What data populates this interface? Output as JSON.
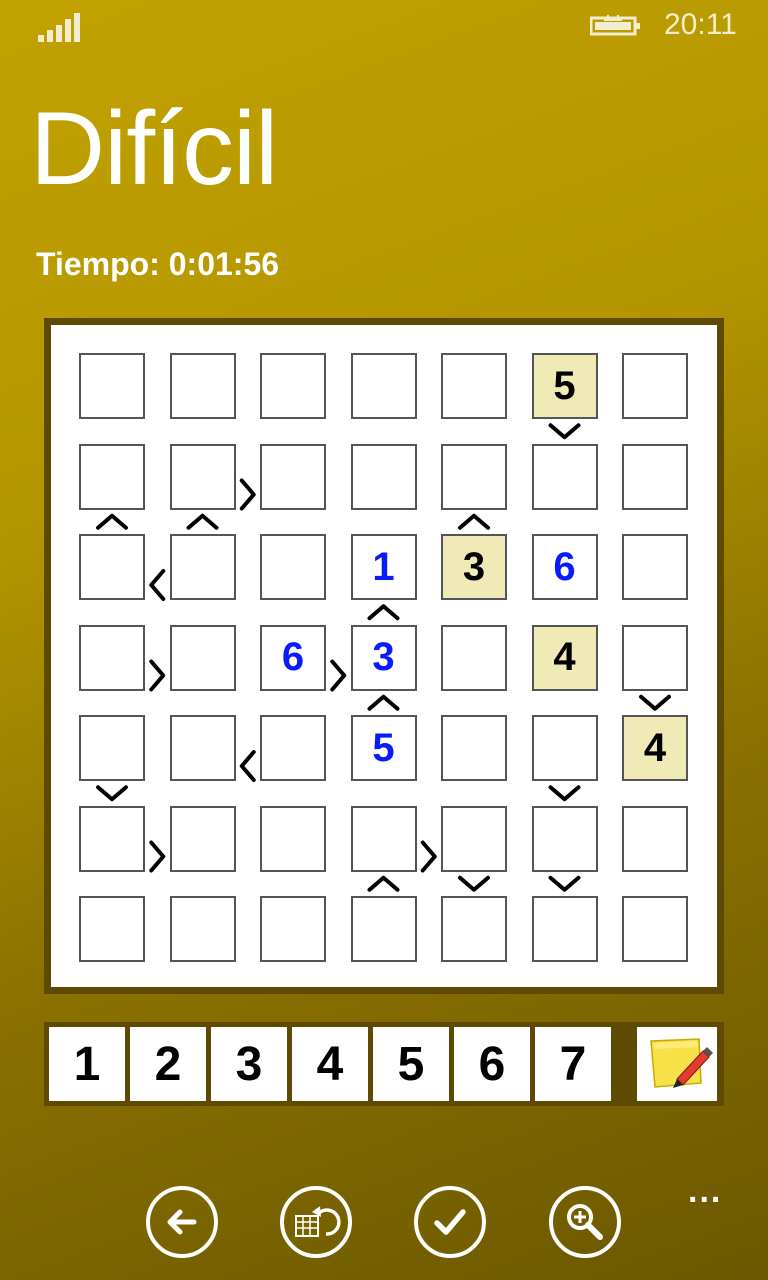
{
  "status_bar": {
    "time": "20:11",
    "signal_icon": "signal-bars-icon",
    "battery_icon": "battery-charging-icon"
  },
  "page": {
    "title": "Difícil",
    "timer": "Tiempo: 0:01:56"
  },
  "board": {
    "size": 7,
    "rows": [
      [
        "",
        "",
        "",
        "",
        "",
        "5",
        ""
      ],
      [
        "",
        "",
        "",
        "",
        "",
        "",
        ""
      ],
      [
        "",
        "",
        "",
        "1",
        "3",
        "6",
        ""
      ],
      [
        "",
        "",
        "6",
        "3",
        "",
        "4",
        ""
      ],
      [
        "",
        "",
        "",
        "5",
        "",
        "",
        "4"
      ],
      [
        "",
        "",
        "",
        "",
        "",
        "",
        ""
      ],
      [
        "",
        "",
        "",
        "",
        "",
        "",
        ""
      ]
    ],
    "cell_kinds": [
      [
        "empty",
        "empty",
        "empty",
        "empty",
        "empty",
        "given",
        "empty"
      ],
      [
        "empty",
        "empty",
        "empty",
        "empty",
        "empty",
        "empty",
        "empty"
      ],
      [
        "empty",
        "empty",
        "empty",
        "user",
        "given",
        "user",
        "empty"
      ],
      [
        "empty",
        "empty",
        "user",
        "user",
        "empty",
        "given",
        "empty"
      ],
      [
        "empty",
        "empty",
        "empty",
        "user",
        "empty",
        "empty",
        "given"
      ],
      [
        "empty",
        "empty",
        "empty",
        "empty",
        "empty",
        "empty",
        "empty"
      ],
      [
        "empty",
        "empty",
        "empty",
        "empty",
        "empty",
        "empty",
        "empty"
      ]
    ],
    "h_constraints": [
      {
        "row": 1,
        "col": 1,
        "sign": ">"
      },
      {
        "row": 2,
        "col": 0,
        "sign": "<"
      },
      {
        "row": 3,
        "col": 0,
        "sign": ">"
      },
      {
        "row": 3,
        "col": 2,
        "sign": ">"
      },
      {
        "row": 4,
        "col": 1,
        "sign": "<"
      },
      {
        "row": 5,
        "col": 0,
        "sign": ">"
      },
      {
        "row": 5,
        "col": 3,
        "sign": ">"
      }
    ],
    "v_constraints": [
      {
        "row": 0,
        "col": 5,
        "sign": "v"
      },
      {
        "row": 1,
        "col": 0,
        "sign": "^"
      },
      {
        "row": 1,
        "col": 1,
        "sign": "^"
      },
      {
        "row": 1,
        "col": 4,
        "sign": "^"
      },
      {
        "row": 2,
        "col": 3,
        "sign": "^"
      },
      {
        "row": 3,
        "col": 3,
        "sign": "^"
      },
      {
        "row": 3,
        "col": 6,
        "sign": "v"
      },
      {
        "row": 4,
        "col": 0,
        "sign": "v"
      },
      {
        "row": 4,
        "col": 5,
        "sign": "v"
      },
      {
        "row": 5,
        "col": 3,
        "sign": "^"
      },
      {
        "row": 5,
        "col": 4,
        "sign": "v"
      },
      {
        "row": 5,
        "col": 5,
        "sign": "v"
      }
    ],
    "colors": {
      "given_bg": "#f0eab6",
      "user_digit": "#0a1aff",
      "frame": "#5e4a00"
    }
  },
  "number_pad": [
    "1",
    "2",
    "3",
    "4",
    "5",
    "6",
    "7"
  ],
  "notes_button": {
    "icon": "sticky-note-pencil-icon"
  },
  "app_bar": {
    "buttons": [
      {
        "name": "back-button",
        "icon": "arrow-left-icon"
      },
      {
        "name": "undo-button",
        "icon": "calendar-undo-icon"
      },
      {
        "name": "check-button",
        "icon": "checkmark-icon"
      },
      {
        "name": "zoom-button",
        "icon": "magnifier-plus-icon"
      }
    ],
    "more": "..."
  }
}
